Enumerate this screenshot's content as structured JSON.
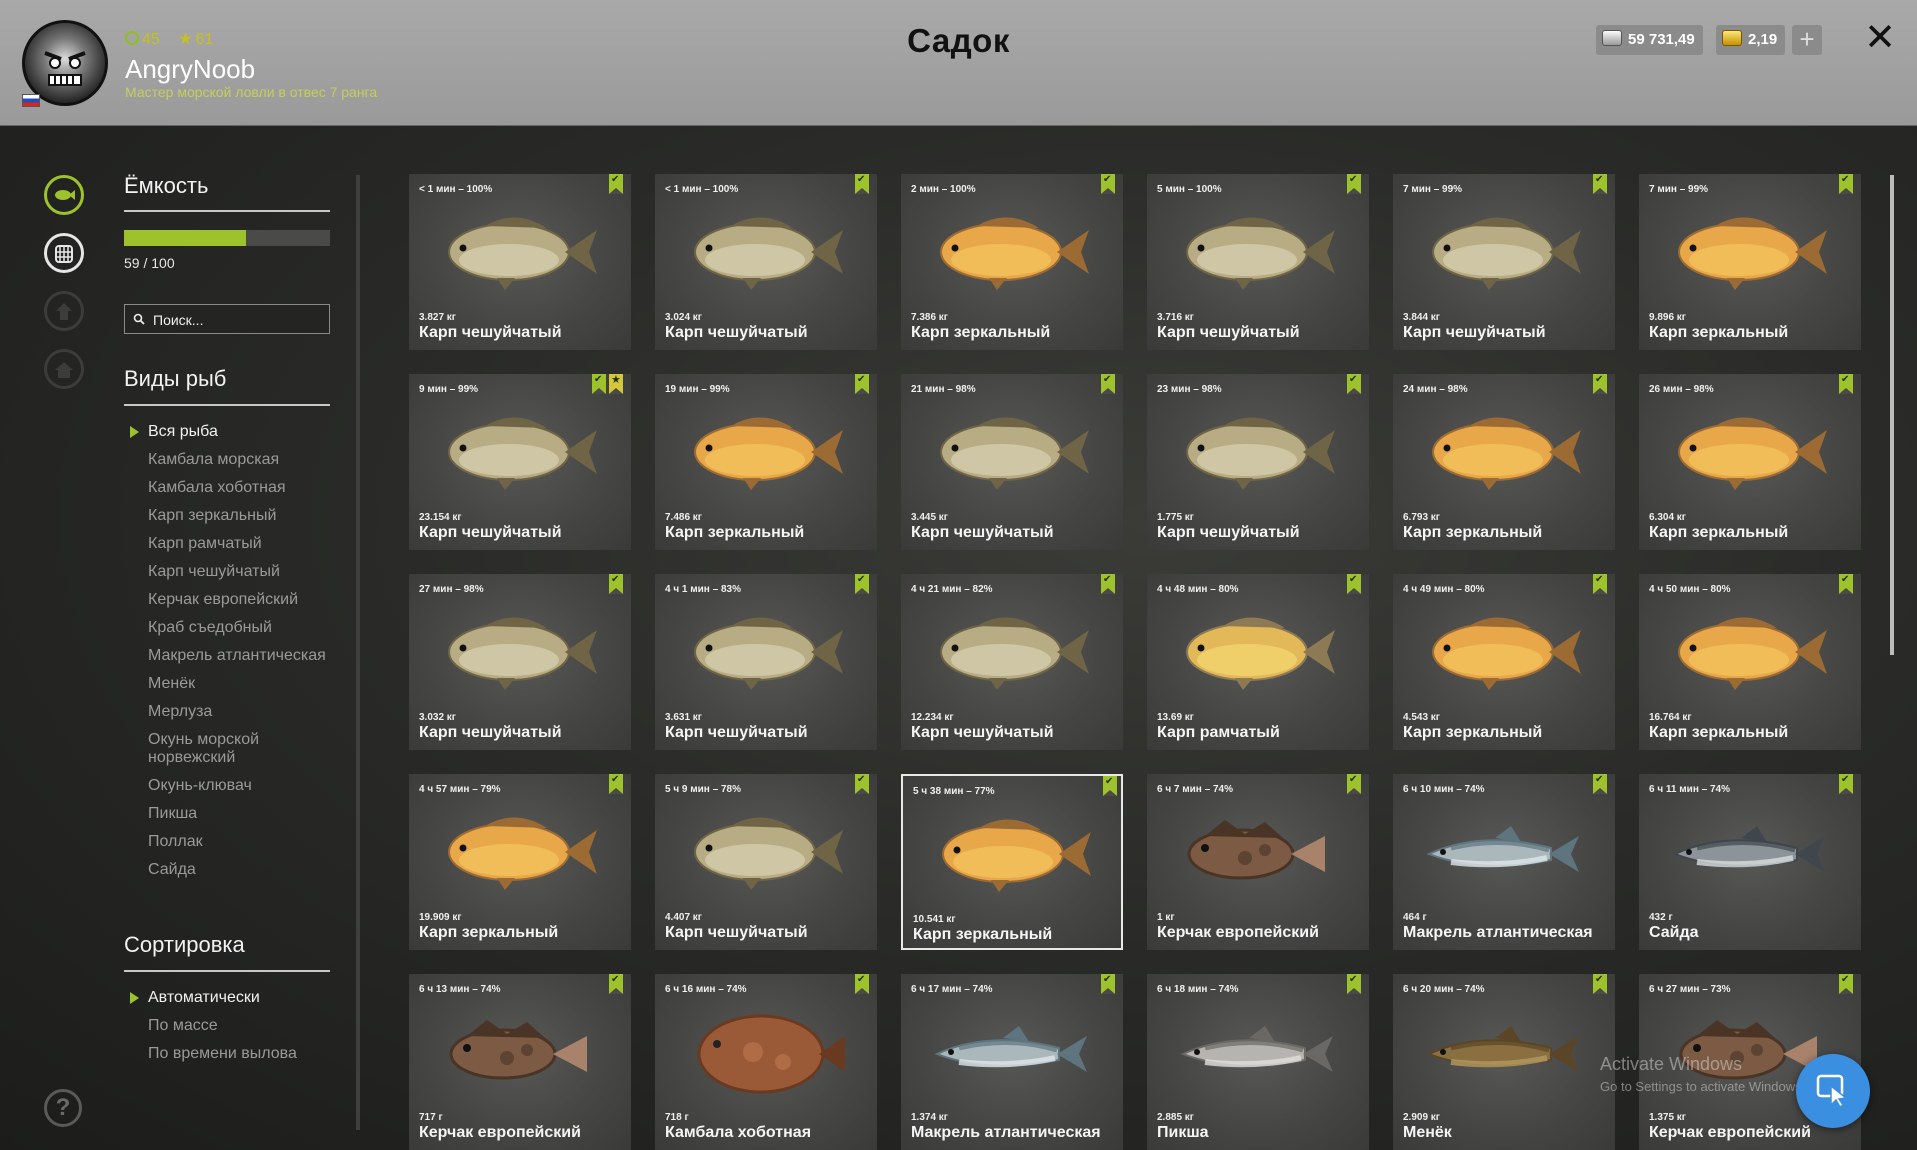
{
  "header": {
    "title": "Садок",
    "player": {
      "name": "AngryNoob",
      "rank_text": "Мастер морской ловли в отвес 7 ранга",
      "level_ring": "45",
      "level_star": "61",
      "country_flag": "russia-flag"
    },
    "currency": {
      "silver": "59 731,49",
      "gold": "2,19",
      "add_label": "+"
    },
    "close_label": "✕"
  },
  "colors": {
    "accent": "#9ec22b",
    "header_bg": "#a4a4a4",
    "card_bg": "#4a4a48"
  },
  "icons": {
    "rail": [
      "fish-icon",
      "keepnet-icon",
      "trophy-icon",
      "home-icon"
    ],
    "help": "?"
  },
  "sidebar": {
    "capacity": {
      "title": "Ёмкость",
      "text": "59 / 100",
      "used": 59,
      "max": 100
    },
    "search": {
      "placeholder": "Поиск..."
    },
    "species_title": "Виды рыб",
    "species": [
      "Вся рыба",
      "Камбала морская",
      "Камбала хоботная",
      "Карп зеркальный",
      "Карп рамчатый",
      "Карп чешуйчатый",
      "Керчак европейский",
      "Краб съедобный",
      "Макрель атлантическая",
      "Менёк",
      "Мерлуза",
      "Окунь морской норвежский",
      "Окунь-клювач",
      "Пикша",
      "Поллак",
      "Сайда"
    ],
    "species_active": 0,
    "sort_title": "Сортировка",
    "sort": [
      "Автоматически",
      "По массе",
      "По времени вылова"
    ],
    "sort_active": 0
  },
  "fish_cards": [
    {
      "time": "< 1 мин – 100%",
      "weight": "3.827 кг",
      "name": "Карп чешуйчатый",
      "kind": "carp-scaled"
    },
    {
      "time": "< 1 мин – 100%",
      "weight": "3.024 кг",
      "name": "Карп чешуйчатый",
      "kind": "carp-scaled"
    },
    {
      "time": "2 мин – 100%",
      "weight": "7.386 кг",
      "name": "Карп зеркальный",
      "kind": "carp-mirror"
    },
    {
      "time": "5 мин – 100%",
      "weight": "3.716 кг",
      "name": "Карп чешуйчатый",
      "kind": "carp-scaled"
    },
    {
      "time": "7 мин – 99%",
      "weight": "3.844 кг",
      "name": "Карп чешуйчатый",
      "kind": "carp-scaled"
    },
    {
      "time": "7 мин – 99%",
      "weight": "9.896 кг",
      "name": "Карп зеркальный",
      "kind": "carp-mirror"
    },
    {
      "time": "9 мин – 99%",
      "weight": "23.154 кг",
      "name": "Карп чешуйчатый",
      "kind": "carp-scaled",
      "starred": true
    },
    {
      "time": "19 мин – 99%",
      "weight": "7.486 кг",
      "name": "Карп зеркальный",
      "kind": "carp-mirror"
    },
    {
      "time": "21 мин – 98%",
      "weight": "3.445 кг",
      "name": "Карп чешуйчатый",
      "kind": "carp-scaled"
    },
    {
      "time": "23 мин – 98%",
      "weight": "1.775 кг",
      "name": "Карп чешуйчатый",
      "kind": "carp-scaled"
    },
    {
      "time": "24 мин – 98%",
      "weight": "6.793 кг",
      "name": "Карп зеркальный",
      "kind": "carp-mirror"
    },
    {
      "time": "26 мин – 98%",
      "weight": "6.304 кг",
      "name": "Карп зеркальный",
      "kind": "carp-mirror"
    },
    {
      "time": "27 мин – 98%",
      "weight": "3.032 кг",
      "name": "Карп чешуйчатый",
      "kind": "carp-scaled"
    },
    {
      "time": "4 ч 1 мин – 83%",
      "weight": "3.631 кг",
      "name": "Карп чешуйчатый",
      "kind": "carp-scaled"
    },
    {
      "time": "4 ч 21 мин – 82%",
      "weight": "12.234 кг",
      "name": "Карп чешуйчатый",
      "kind": "carp-scaled"
    },
    {
      "time": "4 ч 48 мин – 80%",
      "weight": "13.69 кг",
      "name": "Карп рамчатый",
      "kind": "carp-frame"
    },
    {
      "time": "4 ч 49 мин – 80%",
      "weight": "4.543 кг",
      "name": "Карп зеркальный",
      "kind": "carp-mirror"
    },
    {
      "time": "4 ч 50 мин – 80%",
      "weight": "16.764 кг",
      "name": "Карп зеркальный",
      "kind": "carp-mirror"
    },
    {
      "time": "4 ч 57 мин – 79%",
      "weight": "19.909 кг",
      "name": "Карп зеркальный",
      "kind": "carp-mirror"
    },
    {
      "time": "5 ч 9 мин – 78%",
      "weight": "4.407 кг",
      "name": "Карп чешуйчатый",
      "kind": "carp-scaled"
    },
    {
      "time": "5 ч 38 мин – 77%",
      "weight": "10.541 кг",
      "name": "Карп зеркальный",
      "kind": "carp-mirror",
      "selected": true
    },
    {
      "time": "6 ч 7 мин – 74%",
      "weight": "1 кг",
      "name": "Керчак европейский",
      "kind": "sculpin"
    },
    {
      "time": "6 ч 10 мин – 74%",
      "weight": "464 г",
      "name": "Макрель атлантическая",
      "kind": "mackerel"
    },
    {
      "time": "6 ч 11 мин – 74%",
      "weight": "432 г",
      "name": "Сайда",
      "kind": "saithe"
    },
    {
      "time": "6 ч 13 мин – 74%",
      "weight": "717 г",
      "name": "Керчак европейский",
      "kind": "sculpin"
    },
    {
      "time": "6 ч 16 мин – 74%",
      "weight": "718 г",
      "name": "Камбала хоботная",
      "kind": "flounder"
    },
    {
      "time": "6 ч 17 мин – 74%",
      "weight": "1.374 кг",
      "name": "Макрель атлантическая",
      "kind": "mackerel"
    },
    {
      "time": "6 ч 18 мин – 74%",
      "weight": "2.885 кг",
      "name": "Пикша",
      "kind": "haddock"
    },
    {
      "time": "6 ч 20 мин – 74%",
      "weight": "2.909 кг",
      "name": "Менёк",
      "kind": "tusk"
    },
    {
      "time": "6 ч 27 мин – 73%",
      "weight": "1.375 кг",
      "name": "Керчак европейский",
      "kind": "sculpin"
    }
  ],
  "watermark": {
    "line1": "Activate Windows",
    "line2": "Go to Settings to activate Windows."
  }
}
